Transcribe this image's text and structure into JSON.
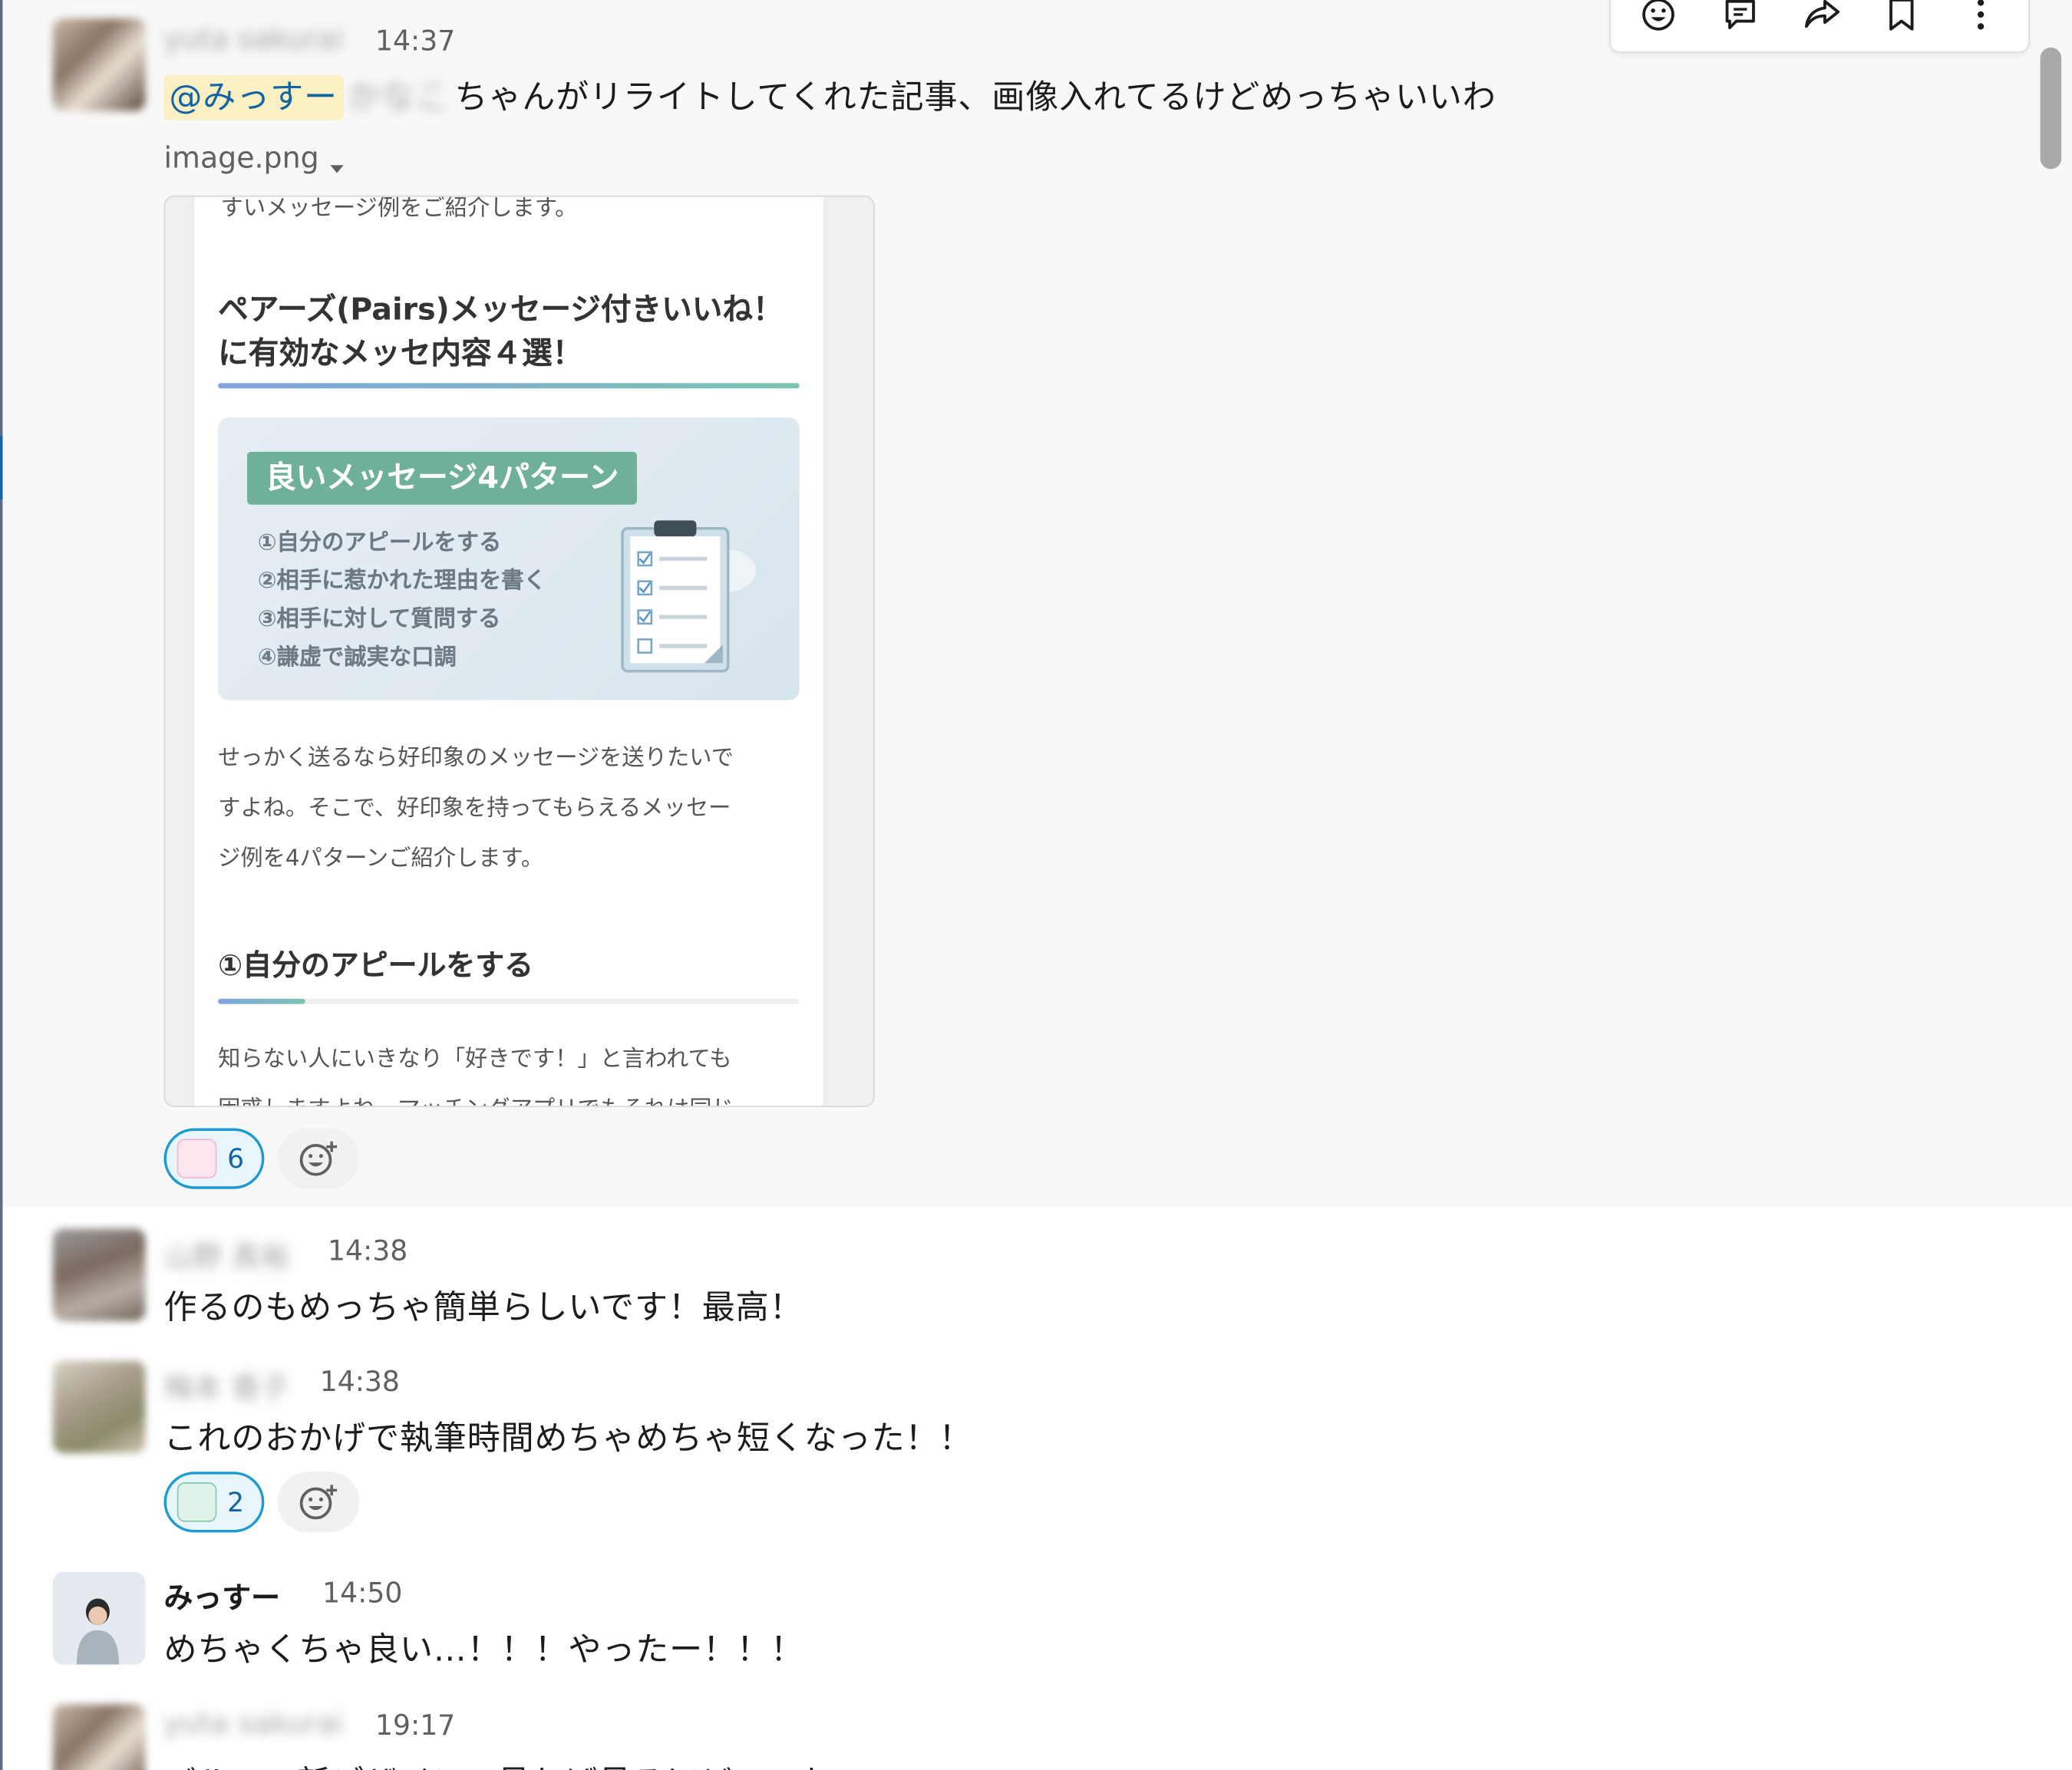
{
  "messages": [
    {
      "sender": "yuta sakurai",
      "time": "14:37",
      "mention": "@みっすー",
      "blurred_inline": "かなこ",
      "text": "ちゃんがリライトしてくれた記事、画像入れてるけどめっちゃいいわ",
      "file": {
        "name": "image.png",
        "preview": {
          "cut_top_text": "すいメッセージ例をご紹介します。",
          "heading_line1": "ペアーズ(Pairs)メッセージ付きいいね！",
          "heading_line2": "に有効なメッセ内容４選！",
          "banner_title": "良いメッセージ4パターン",
          "banner_items": [
            "①自分のアピールをする",
            "②相手に惹かれた理由を書く",
            "③相手に対して質問する",
            "④謙虚で誠実な口調"
          ],
          "paragraph_lines": [
            "せっかく送るなら好印象のメッセージを送りたいで",
            "すよね。そこで、好印象を持ってもらえるメッセー",
            "ジ例を4パターンご紹介します。"
          ],
          "section_heading": "①自分のアピールをする",
          "bottom_line1": "知らない人にいきなり「好きです！」と言われても",
          "bottom_line2_cut": "困惑しますよね。マッチングアプリでもそれは同じ"
        }
      },
      "reaction": {
        "emoji": "sticker-emoji-pink",
        "count": "6"
      }
    },
    {
      "sender": "山野 真裕",
      "time": "14:38",
      "text": "作るのもめっちゃ簡単らしいです！最高！"
    },
    {
      "sender": "梅本 香子",
      "time": "14:38",
      "text": "これのおかげで執筆時間めちゃめちゃ短くなった！！",
      "reaction": {
        "emoji": "sticker-emoji-teal",
        "count": "2"
      }
    },
    {
      "sender": "みっすー",
      "time": "14:50",
      "text": "めちゃくちゃ良い…！！！やったー！！！"
    },
    {
      "sender": "yuta sakurai",
      "time": "19:17",
      "text": "バルーン新デザイン、見れば見るほどいいね"
    }
  ],
  "toolbar": {
    "icons": [
      "add-reaction-icon",
      "reply-in-thread-icon",
      "share-icon",
      "bookmark-icon",
      "more-actions-icon"
    ]
  },
  "colors": {
    "mention_bg": "#fbefc4",
    "mention_text": "#1264a3",
    "reaction_border": "#1d9bd1",
    "banner_title_bg": "#6fb09a"
  }
}
